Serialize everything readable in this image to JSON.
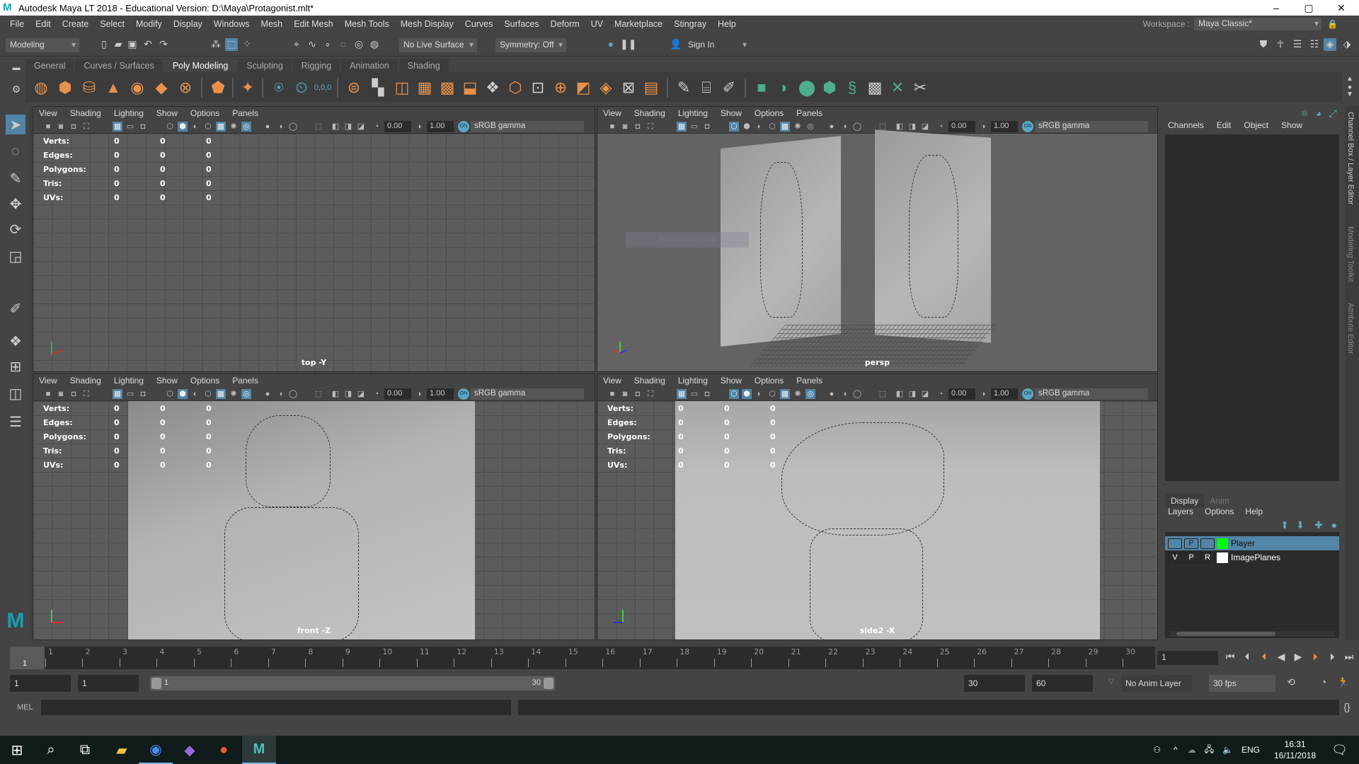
{
  "window": {
    "title": "Autodesk Maya LT 2018 - Educational Version: D:\\Maya\\Protagonist.mlt*",
    "minimize": "–",
    "maximize": "▢",
    "close": "✕"
  },
  "menu": [
    "File",
    "Edit",
    "Create",
    "Select",
    "Modify",
    "Display",
    "Windows",
    "Mesh",
    "Edit Mesh",
    "Mesh Tools",
    "Mesh Display",
    "Curves",
    "Surfaces",
    "Deform",
    "UV",
    "Marketplace",
    "Stingray",
    "Help"
  ],
  "workspace": {
    "label": "Workspace :",
    "value": "Maya Classic*"
  },
  "statusline": {
    "mode": "Modeling",
    "live_surface": "No Live Surface",
    "symmetry": "Symmetry: Off",
    "sign_in": "Sign In"
  },
  "shelf": {
    "tabs": [
      "General",
      "Curves / Surfaces",
      "Poly Modeling",
      "Sculpting",
      "Rigging",
      "Animation",
      "Shading"
    ],
    "active_tab": "Poly Modeling",
    "snap_value": "0,0,0"
  },
  "panel_menu": [
    "View",
    "Shading",
    "Lighting",
    "Show",
    "Options",
    "Panels"
  ],
  "panel_toolbar": {
    "exposure": "0.00",
    "gamma": "1.00",
    "color_space": "sRGB gamma",
    "on": "ON"
  },
  "hud": {
    "rows": [
      {
        "label": "Verts:",
        "values": [
          "0",
          "0",
          "0"
        ]
      },
      {
        "label": "Edges:",
        "values": [
          "0",
          "0",
          "0"
        ]
      },
      {
        "label": "Polygons:",
        "values": [
          "0",
          "0",
          "0"
        ]
      },
      {
        "label": "Tris:",
        "values": [
          "0",
          "0",
          "0"
        ]
      },
      {
        "label": "UVs:",
        "values": [
          "0",
          "0",
          "0"
        ]
      }
    ]
  },
  "viewports": [
    {
      "camera": "top -Y"
    },
    {
      "camera": "persp"
    },
    {
      "camera": "front -Z"
    },
    {
      "camera": "side2 -X"
    }
  ],
  "overlay": {
    "snip": "Full-screen Snip"
  },
  "channel_box": {
    "menu": [
      "Channels",
      "Edit",
      "Object",
      "Show"
    ]
  },
  "layer_editor": {
    "tabs": [
      "Display",
      "Anim"
    ],
    "active_tab": "Display",
    "menu": [
      "Layers",
      "Options",
      "Help"
    ],
    "layers": [
      {
        "v": "",
        "p": "P",
        "r": "",
        "name": "Player",
        "color": "#00ff00",
        "selected": true
      },
      {
        "v": "V",
        "p": "P",
        "r": "R",
        "name": "ImagePlanes",
        "color": "#ffffff",
        "selected": false
      }
    ]
  },
  "side_tabs": [
    "Channel Box / Layer Editor",
    "Modeling Toolkit",
    "Attribute Editor"
  ],
  "timeline": {
    "start": 1,
    "end": 30,
    "current": "1",
    "ticks": [
      "1",
      "2",
      "3",
      "4",
      "5",
      "6",
      "7",
      "8",
      "9",
      "10",
      "11",
      "12",
      "13",
      "14",
      "15",
      "16",
      "17",
      "18",
      "19",
      "20",
      "21",
      "22",
      "23",
      "24",
      "25",
      "26",
      "27",
      "28",
      "29",
      "30"
    ]
  },
  "range": {
    "anim_start": "1",
    "playback_start": "1",
    "slider_start": "1",
    "slider_end": "30",
    "playback_end": "30",
    "anim_end": "60",
    "anim_layer": "No Anim Layer",
    "fps": "30 fps"
  },
  "command_line": {
    "language": "MEL"
  },
  "taskbar": {
    "apps": [
      "start",
      "search",
      "task-view",
      "file-explorer",
      "chrome",
      "visual-studio",
      "app-orange",
      "maya-lt"
    ],
    "lang": "ENG",
    "time": "16:31",
    "date": "16/11/2018"
  }
}
